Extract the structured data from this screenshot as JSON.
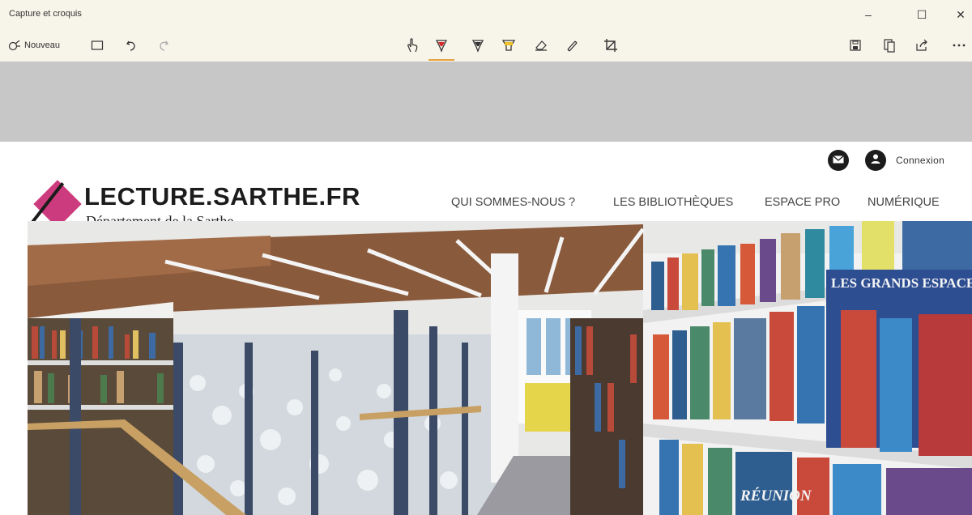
{
  "app": {
    "title": "Capture et croquis",
    "new_label": "Nouveau",
    "icons": [
      "new-snip-icon",
      "full-screen-snip-icon",
      "undo-icon",
      "redo-icon",
      "touch-writing-icon",
      "ballpoint-pen-icon",
      "pencil-icon",
      "highlighter-icon",
      "eraser-icon",
      "ruler-icon",
      "crop-icon",
      "save-icon",
      "copy-icon",
      "share-icon",
      "more-icon"
    ],
    "pen_colors": {
      "ballpoint": "#d62727",
      "pencil": "#333333",
      "highlighter": "#f0c22a"
    },
    "accent": "#e8a33c"
  },
  "window_controls": {
    "minimize": "–",
    "maximize": "☐",
    "close": "✕"
  },
  "site": {
    "header": {
      "connexion_label": "Connexion",
      "icons": [
        "mail-icon",
        "user-icon"
      ]
    },
    "logo": {
      "name": "LECTURE.SARTHE.FR",
      "subtitle": "Département de la Sarthe",
      "brand_color": "#cc3b7e"
    },
    "nav": [
      {
        "label": "QUI SOMMES-NOUS ?"
      },
      {
        "label": "LES BIBLIOTHÈQUES"
      },
      {
        "label": "ESPACE PRO"
      },
      {
        "label": "NUMÉRIQUE"
      }
    ],
    "hero": {
      "book_title_1": "LES GRANDS ESPACES",
      "book_title_2": "RÉUNION"
    }
  }
}
